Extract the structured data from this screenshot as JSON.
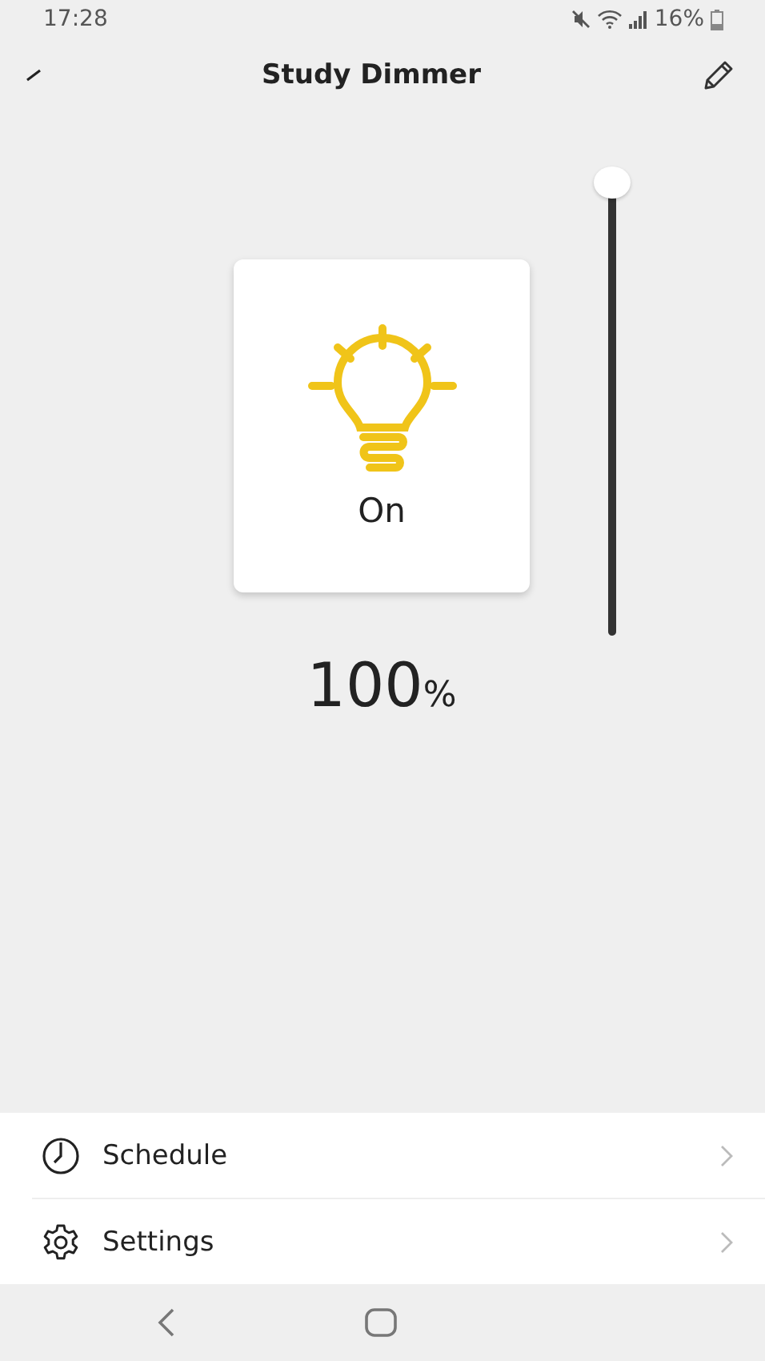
{
  "status_bar": {
    "time": "17:28",
    "battery": "16%"
  },
  "header": {
    "title": "Study Dimmer"
  },
  "device": {
    "on": true,
    "state_label": "On",
    "level": 1,
    "reading": "100",
    "unit": "%"
  },
  "menu": [
    {
      "kind": "clock",
      "label": "Schedule"
    },
    {
      "kind": "gear",
      "label": "Settings"
    }
  ]
}
